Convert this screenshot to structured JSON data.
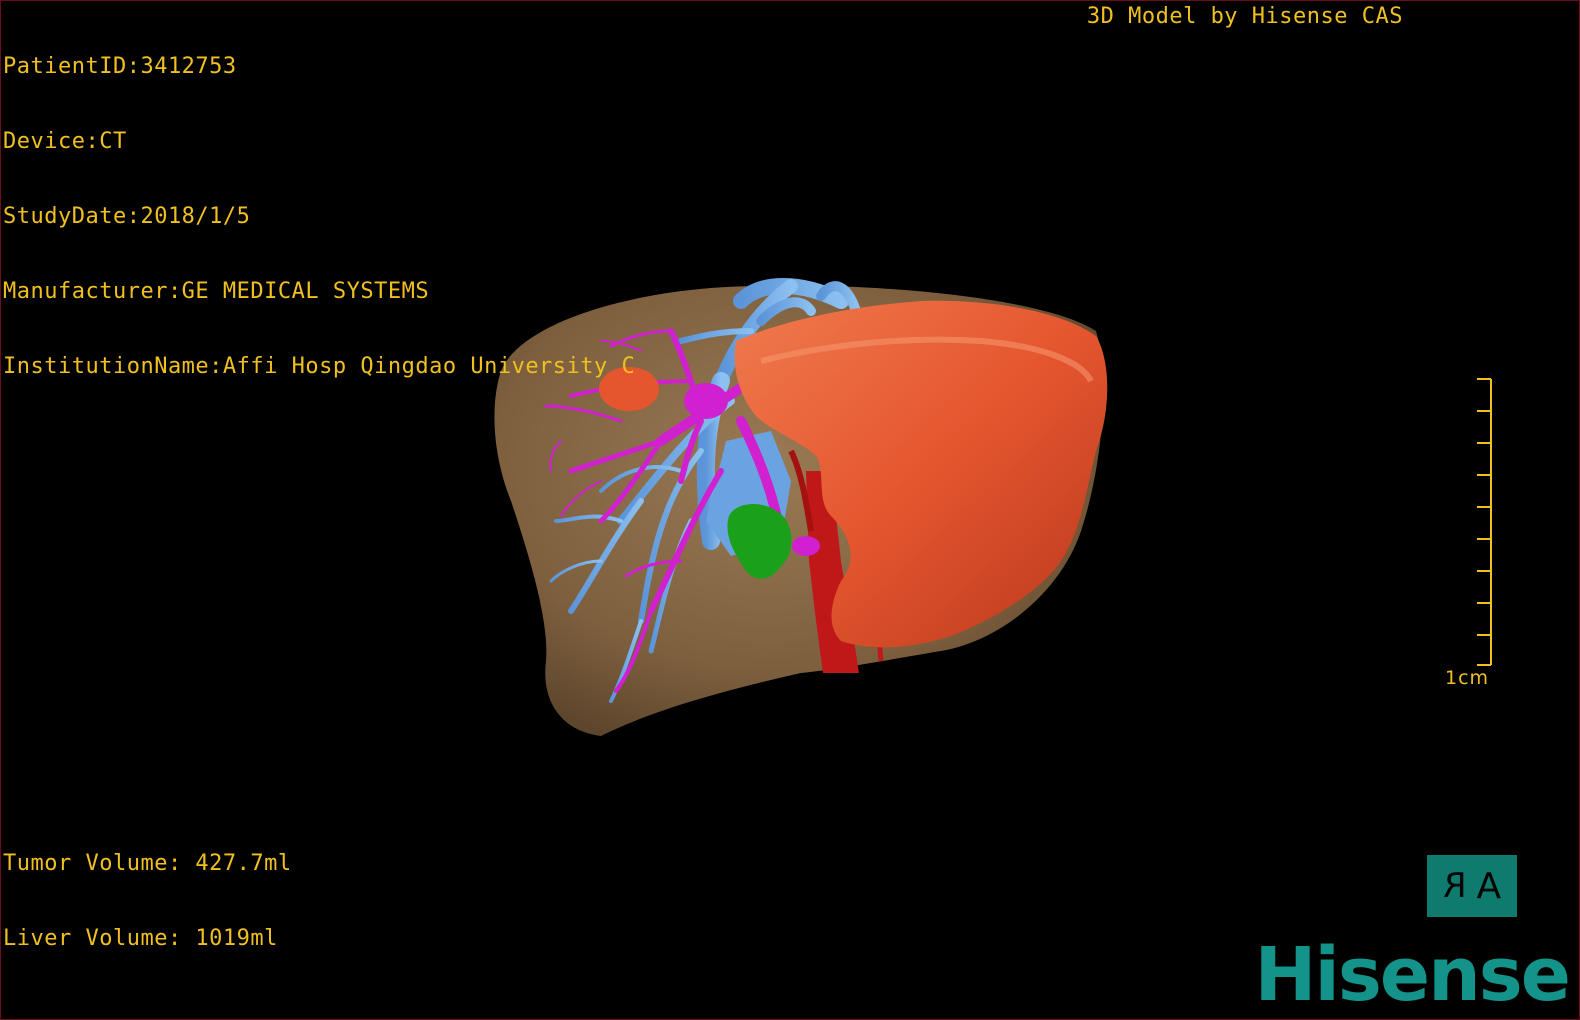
{
  "header": {
    "patient_id": "PatientID:3412753",
    "device": "Device:CT",
    "study_date": "StudyDate:2018/1/5",
    "manufacturer": "Manufacturer:GE MEDICAL SYSTEMS",
    "institution": "InstitutionName:Affi Hosp Qingdao University C"
  },
  "model_credit": "3D Model by Hisense CAS",
  "volumes": {
    "tumor": "Tumor Volume: 427.7ml",
    "liver": "Liver Volume: 1019ml"
  },
  "scale_bar": {
    "label": "1cm"
  },
  "orientation": {
    "left_marker": "R",
    "right_marker": "A"
  },
  "brand": "Hisense",
  "colors": {
    "overlay_text": "#f0c020",
    "liver": "#8a6a46",
    "tumor": "#e5562f",
    "portal_vein": "#6aa3e0",
    "hepatic_vein": "#d020d0",
    "artery": "#c01818",
    "gallbladder": "#1aa01a",
    "brand": "#14938a"
  }
}
